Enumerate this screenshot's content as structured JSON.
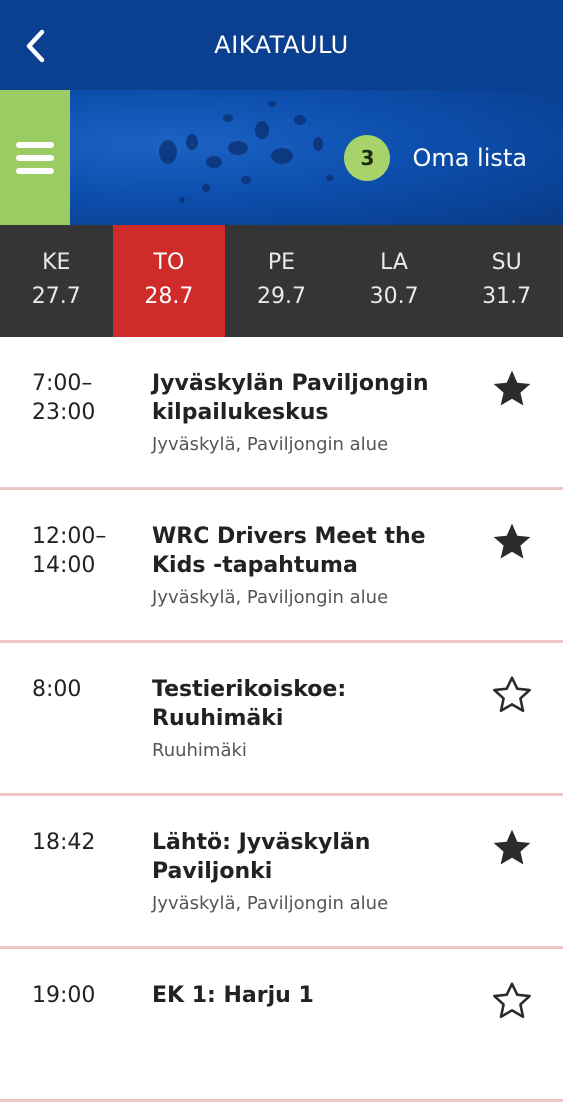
{
  "header": {
    "title": "AIKATAULU"
  },
  "banner": {
    "list_count": "3",
    "list_label": "Oma lista"
  },
  "days": [
    {
      "name": "KE",
      "date": "27.7",
      "active": false
    },
    {
      "name": "TO",
      "date": "28.7",
      "active": true
    },
    {
      "name": "PE",
      "date": "29.7",
      "active": false
    },
    {
      "name": "LA",
      "date": "30.7",
      "active": false
    },
    {
      "name": "SU",
      "date": "31.7",
      "active": false
    }
  ],
  "events": [
    {
      "time_start": "7:00–",
      "time_end": "23:00",
      "title_1": "Jyväskylän Paviljongin",
      "title_2": "kilpailukeskus",
      "place": "Jyväskylä, Paviljongin alue",
      "favorite": true
    },
    {
      "time_start": "12:00–",
      "time_end": "14:00",
      "title_1": "WRC Drivers Meet the",
      "title_2": "Kids -tapahtuma",
      "place": "Jyväskylä, Paviljongin alue",
      "favorite": true
    },
    {
      "time_start": "8:00",
      "time_end": "",
      "title_1": "Testierikoiskoe:",
      "title_2": "Ruuhimäki",
      "place": "Ruuhimäki",
      "favorite": false
    },
    {
      "time_start": "18:42",
      "time_end": "",
      "title_1": "Lähtö: Jyväskylän",
      "title_2": "Paviljonki",
      "place": "Jyväskylä, Paviljongin alue",
      "favorite": true
    },
    {
      "time_start": "19:00",
      "time_end": "",
      "title_1": "EK 1: Harju 1",
      "title_2": "",
      "place": "",
      "favorite": false
    }
  ],
  "colors": {
    "header_bg": "#0b3f8f",
    "menu_green": "#9bcb63",
    "badge_green": "#a8d36a",
    "daybar_bg": "#353535",
    "active_day": "#cf2b2b",
    "divider": "#efc7c7"
  },
  "icons": {
    "back": "chevron-left-icon",
    "menu": "hamburger-menu-icon",
    "favorite_on": "star-filled-icon",
    "favorite_off": "star-outline-icon"
  }
}
